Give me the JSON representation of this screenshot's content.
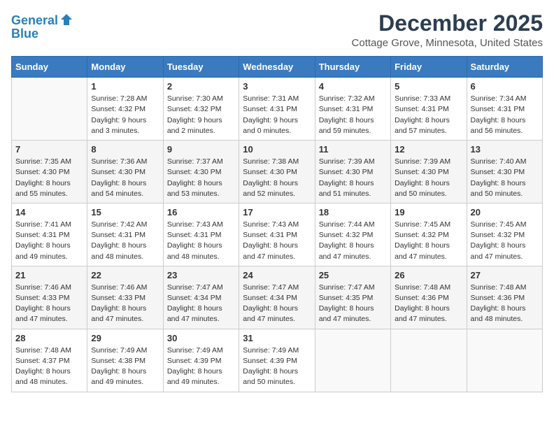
{
  "header": {
    "logo_line1": "General",
    "logo_line2": "Blue",
    "title": "December 2025",
    "location": "Cottage Grove, Minnesota, United States"
  },
  "columns": [
    "Sunday",
    "Monday",
    "Tuesday",
    "Wednesday",
    "Thursday",
    "Friday",
    "Saturday"
  ],
  "weeks": [
    [
      {
        "day": "",
        "info": ""
      },
      {
        "day": "1",
        "info": "Sunrise: 7:28 AM\nSunset: 4:32 PM\nDaylight: 9 hours\nand 3 minutes."
      },
      {
        "day": "2",
        "info": "Sunrise: 7:30 AM\nSunset: 4:32 PM\nDaylight: 9 hours\nand 2 minutes."
      },
      {
        "day": "3",
        "info": "Sunrise: 7:31 AM\nSunset: 4:31 PM\nDaylight: 9 hours\nand 0 minutes."
      },
      {
        "day": "4",
        "info": "Sunrise: 7:32 AM\nSunset: 4:31 PM\nDaylight: 8 hours\nand 59 minutes."
      },
      {
        "day": "5",
        "info": "Sunrise: 7:33 AM\nSunset: 4:31 PM\nDaylight: 8 hours\nand 57 minutes."
      },
      {
        "day": "6",
        "info": "Sunrise: 7:34 AM\nSunset: 4:31 PM\nDaylight: 8 hours\nand 56 minutes."
      }
    ],
    [
      {
        "day": "7",
        "info": "Sunrise: 7:35 AM\nSunset: 4:30 PM\nDaylight: 8 hours\nand 55 minutes."
      },
      {
        "day": "8",
        "info": "Sunrise: 7:36 AM\nSunset: 4:30 PM\nDaylight: 8 hours\nand 54 minutes."
      },
      {
        "day": "9",
        "info": "Sunrise: 7:37 AM\nSunset: 4:30 PM\nDaylight: 8 hours\nand 53 minutes."
      },
      {
        "day": "10",
        "info": "Sunrise: 7:38 AM\nSunset: 4:30 PM\nDaylight: 8 hours\nand 52 minutes."
      },
      {
        "day": "11",
        "info": "Sunrise: 7:39 AM\nSunset: 4:30 PM\nDaylight: 8 hours\nand 51 minutes."
      },
      {
        "day": "12",
        "info": "Sunrise: 7:39 AM\nSunset: 4:30 PM\nDaylight: 8 hours\nand 50 minutes."
      },
      {
        "day": "13",
        "info": "Sunrise: 7:40 AM\nSunset: 4:30 PM\nDaylight: 8 hours\nand 50 minutes."
      }
    ],
    [
      {
        "day": "14",
        "info": "Sunrise: 7:41 AM\nSunset: 4:31 PM\nDaylight: 8 hours\nand 49 minutes."
      },
      {
        "day": "15",
        "info": "Sunrise: 7:42 AM\nSunset: 4:31 PM\nDaylight: 8 hours\nand 48 minutes."
      },
      {
        "day": "16",
        "info": "Sunrise: 7:43 AM\nSunset: 4:31 PM\nDaylight: 8 hours\nand 48 minutes."
      },
      {
        "day": "17",
        "info": "Sunrise: 7:43 AM\nSunset: 4:31 PM\nDaylight: 8 hours\nand 47 minutes."
      },
      {
        "day": "18",
        "info": "Sunrise: 7:44 AM\nSunset: 4:32 PM\nDaylight: 8 hours\nand 47 minutes."
      },
      {
        "day": "19",
        "info": "Sunrise: 7:45 AM\nSunset: 4:32 PM\nDaylight: 8 hours\nand 47 minutes."
      },
      {
        "day": "20",
        "info": "Sunrise: 7:45 AM\nSunset: 4:32 PM\nDaylight: 8 hours\nand 47 minutes."
      }
    ],
    [
      {
        "day": "21",
        "info": "Sunrise: 7:46 AM\nSunset: 4:33 PM\nDaylight: 8 hours\nand 47 minutes."
      },
      {
        "day": "22",
        "info": "Sunrise: 7:46 AM\nSunset: 4:33 PM\nDaylight: 8 hours\nand 47 minutes."
      },
      {
        "day": "23",
        "info": "Sunrise: 7:47 AM\nSunset: 4:34 PM\nDaylight: 8 hours\nand 47 minutes."
      },
      {
        "day": "24",
        "info": "Sunrise: 7:47 AM\nSunset: 4:34 PM\nDaylight: 8 hours\nand 47 minutes."
      },
      {
        "day": "25",
        "info": "Sunrise: 7:47 AM\nSunset: 4:35 PM\nDaylight: 8 hours\nand 47 minutes."
      },
      {
        "day": "26",
        "info": "Sunrise: 7:48 AM\nSunset: 4:36 PM\nDaylight: 8 hours\nand 47 minutes."
      },
      {
        "day": "27",
        "info": "Sunrise: 7:48 AM\nSunset: 4:36 PM\nDaylight: 8 hours\nand 48 minutes."
      }
    ],
    [
      {
        "day": "28",
        "info": "Sunrise: 7:48 AM\nSunset: 4:37 PM\nDaylight: 8 hours\nand 48 minutes."
      },
      {
        "day": "29",
        "info": "Sunrise: 7:49 AM\nSunset: 4:38 PM\nDaylight: 8 hours\nand 49 minutes."
      },
      {
        "day": "30",
        "info": "Sunrise: 7:49 AM\nSunset: 4:39 PM\nDaylight: 8 hours\nand 49 minutes."
      },
      {
        "day": "31",
        "info": "Sunrise: 7:49 AM\nSunset: 4:39 PM\nDaylight: 8 hours\nand 50 minutes."
      },
      {
        "day": "",
        "info": ""
      },
      {
        "day": "",
        "info": ""
      },
      {
        "day": "",
        "info": ""
      }
    ]
  ]
}
